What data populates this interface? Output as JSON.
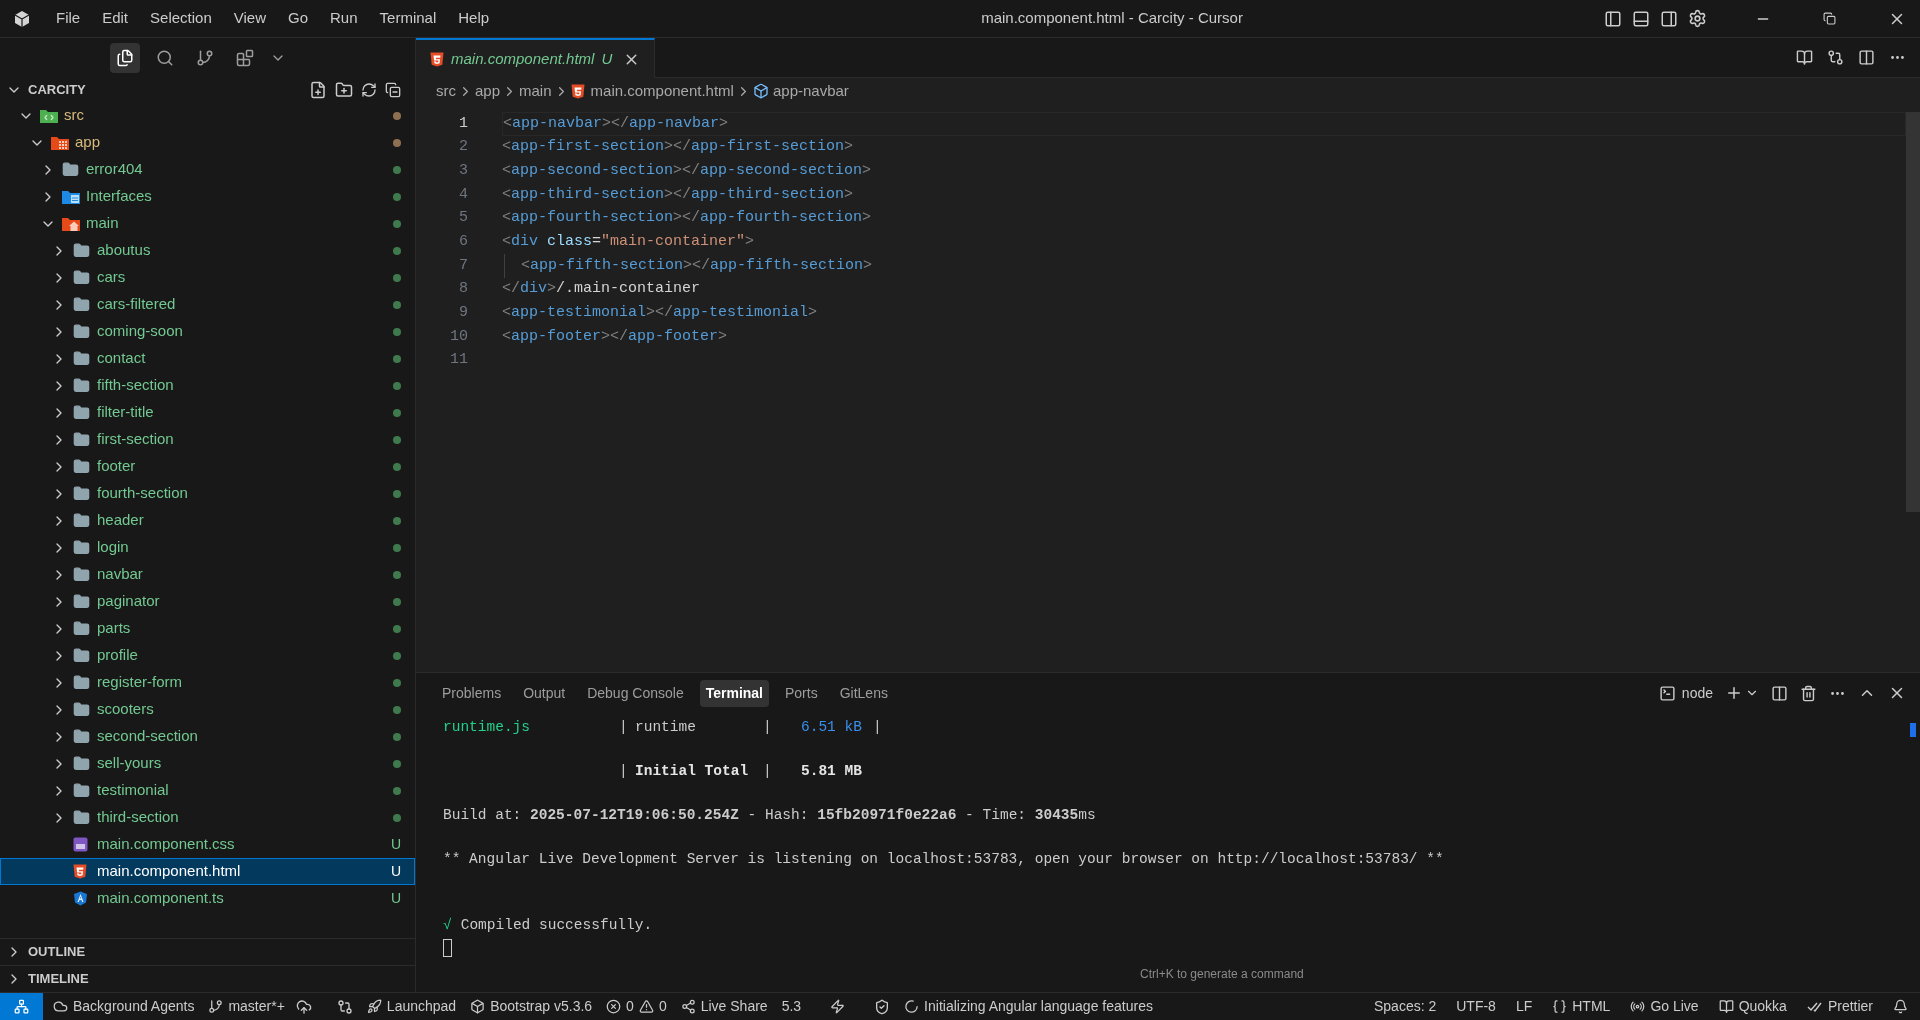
{
  "title_bar": {
    "menu": [
      "File",
      "Edit",
      "Selection",
      "View",
      "Go",
      "Run",
      "Terminal",
      "Help"
    ],
    "title": "main.component.html - Carcity - Cursor"
  },
  "activity": [
    {
      "selected": true
    },
    {
      "selected": false
    },
    {
      "selected": false
    },
    {
      "selected": false
    }
  ],
  "explorer": {
    "title": "CARCITY",
    "tree": [
      {
        "name": "src",
        "kind": "source",
        "modified": true,
        "expanded": true,
        "selected": false,
        "children": [
          {
            "name": "app",
            "kind": "app",
            "modified": true,
            "expanded": true,
            "selected": false,
            "children": [
              {
                "name": "error404",
                "kind": "folder",
                "modified": false,
                "expanded": false,
                "selected": false
              },
              {
                "name": "Interfaces",
                "kind": "interfaces",
                "modified": false,
                "expanded": false,
                "selected": false
              },
              {
                "name": "main",
                "kind": "home",
                "modified": false,
                "expanded": true,
                "selected": false,
                "children": [
                  {
                    "name": "aboutus",
                    "kind": "folder",
                    "modified": false,
                    "expanded": false,
                    "selected": false
                  },
                  {
                    "name": "cars",
                    "kind": "folder",
                    "modified": false,
                    "expanded": false,
                    "selected": false
                  },
                  {
                    "name": "cars-filtered",
                    "kind": "folder",
                    "modified": false,
                    "expanded": false,
                    "selected": false
                  },
                  {
                    "name": "coming-soon",
                    "kind": "folder",
                    "modified": false,
                    "expanded": false,
                    "selected": false
                  },
                  {
                    "name": "contact",
                    "kind": "folder",
                    "modified": false,
                    "expanded": false,
                    "selected": false
                  },
                  {
                    "name": "fifth-section",
                    "kind": "folder",
                    "modified": false,
                    "expanded": false,
                    "selected": false
                  },
                  {
                    "name": "filter-title",
                    "kind": "folder",
                    "modified": false,
                    "expanded": false,
                    "selected": false
                  },
                  {
                    "name": "first-section",
                    "kind": "folder",
                    "modified": false,
                    "expanded": false,
                    "selected": false
                  },
                  {
                    "name": "footer",
                    "kind": "folder",
                    "modified": false,
                    "expanded": false,
                    "selected": false
                  },
                  {
                    "name": "fourth-section",
                    "kind": "folder",
                    "modified": false,
                    "expanded": false,
                    "selected": false
                  },
                  {
                    "name": "header",
                    "kind": "folder",
                    "modified": false,
                    "expanded": false,
                    "selected": false
                  },
                  {
                    "name": "login",
                    "kind": "folder",
                    "modified": false,
                    "expanded": false,
                    "selected": false
                  },
                  {
                    "name": "navbar",
                    "kind": "folder",
                    "modified": false,
                    "expanded": false,
                    "selected": false
                  },
                  {
                    "name": "paginator",
                    "kind": "folder",
                    "modified": false,
                    "expanded": false,
                    "selected": false
                  },
                  {
                    "name": "parts",
                    "kind": "folder",
                    "modified": false,
                    "expanded": false,
                    "selected": false
                  },
                  {
                    "name": "profile",
                    "kind": "folder",
                    "modified": false,
                    "expanded": false,
                    "selected": false
                  },
                  {
                    "name": "register-form",
                    "kind": "folder",
                    "modified": false,
                    "expanded": false,
                    "selected": false
                  },
                  {
                    "name": "scooters",
                    "kind": "folder",
                    "modified": false,
                    "expanded": false,
                    "selected": false
                  },
                  {
                    "name": "second-section",
                    "kind": "folder",
                    "modified": false,
                    "expanded": false,
                    "selected": false
                  },
                  {
                    "name": "sell-yours",
                    "kind": "folder",
                    "modified": false,
                    "expanded": false,
                    "selected": false
                  },
                  {
                    "name": "testimonial",
                    "kind": "folder",
                    "modified": false,
                    "expanded": false,
                    "selected": false
                  },
                  {
                    "name": "third-section",
                    "kind": "folder",
                    "modified": false,
                    "expanded": false,
                    "selected": false
                  },
                  {
                    "name": "main.component.css",
                    "kind": "stylesheet",
                    "modified": false,
                    "badge": "U",
                    "selected": false
                  },
                  {
                    "name": "main.component.html",
                    "kind": "html",
                    "modified": false,
                    "badge": "U",
                    "selected": true
                  },
                  {
                    "name": "main.component.ts",
                    "kind": "angular",
                    "modified": false,
                    "badge": "U",
                    "selected": false
                  }
                ]
              }
            ]
          }
        ]
      }
    ]
  },
  "sections": [
    {
      "label": "OUTLINE",
      "expanded": false
    },
    {
      "label": "TIMELINE",
      "expanded": false
    }
  ],
  "editor": {
    "tabs": [
      {
        "label": "main.component.html",
        "status": "U",
        "selected": true
      }
    ],
    "breadcrumbs": [
      "src",
      "app",
      "main",
      "main.component.html",
      "app-navbar"
    ],
    "lines": [
      {
        "number": "1",
        "current": true,
        "tokens": [
          {
            "text": "<",
            "kind": "punct"
          },
          {
            "text": "app-navbar",
            "kind": "tag"
          },
          {
            "text": "></",
            "kind": "punct"
          },
          {
            "text": "app-navbar",
            "kind": "tag"
          },
          {
            "text": ">",
            "kind": "punct"
          }
        ]
      },
      {
        "number": "2",
        "current": false,
        "tokens": [
          {
            "text": "<",
            "kind": "punct"
          },
          {
            "text": "app-first-section",
            "kind": "tag"
          },
          {
            "text": "></",
            "kind": "punct"
          },
          {
            "text": "app-first-section",
            "kind": "tag"
          },
          {
            "text": ">",
            "kind": "punct"
          }
        ]
      },
      {
        "number": "3",
        "current": false,
        "tokens": [
          {
            "text": "<",
            "kind": "punct"
          },
          {
            "text": "app-second-section",
            "kind": "tag"
          },
          {
            "text": "></",
            "kind": "punct"
          },
          {
            "text": "app-second-section",
            "kind": "tag"
          },
          {
            "text": ">",
            "kind": "punct"
          }
        ]
      },
      {
        "number": "4",
        "current": false,
        "tokens": [
          {
            "text": "<",
            "kind": "punct"
          },
          {
            "text": "app-third-section",
            "kind": "tag"
          },
          {
            "text": "></",
            "kind": "punct"
          },
          {
            "text": "app-third-section",
            "kind": "tag"
          },
          {
            "text": ">",
            "kind": "punct"
          }
        ]
      },
      {
        "number": "5",
        "current": false,
        "tokens": [
          {
            "text": "<",
            "kind": "punct"
          },
          {
            "text": "app-fourth-section",
            "kind": "tag"
          },
          {
            "text": "></",
            "kind": "punct"
          },
          {
            "text": "app-fourth-section",
            "kind": "tag"
          },
          {
            "text": ">",
            "kind": "punct"
          }
        ]
      },
      {
        "number": "6",
        "current": false,
        "tokens": [
          {
            "text": "<",
            "kind": "punct"
          },
          {
            "text": "div",
            "kind": "tag"
          },
          {
            "text": " class",
            "kind": "attr"
          },
          {
            "text": "=",
            "kind": "plain"
          },
          {
            "text": "\"main-container\"",
            "kind": "string"
          },
          {
            "text": ">",
            "kind": "punct"
          }
        ]
      },
      {
        "number": "7",
        "current": false,
        "indent": true,
        "tokens": [
          {
            "text": "<",
            "kind": "punct"
          },
          {
            "text": "app-fifth-section",
            "kind": "tag"
          },
          {
            "text": "></",
            "kind": "punct"
          },
          {
            "text": "app-fifth-section",
            "kind": "tag"
          },
          {
            "text": ">",
            "kind": "punct"
          }
        ]
      },
      {
        "number": "8",
        "current": false,
        "tokens": [
          {
            "text": "</",
            "kind": "punct"
          },
          {
            "text": "div",
            "kind": "tag"
          },
          {
            "text": ">",
            "kind": "punct"
          },
          {
            "text": "/.main-container",
            "kind": "plain"
          }
        ]
      },
      {
        "number": "9",
        "current": false,
        "tokens": [
          {
            "text": "<",
            "kind": "punct"
          },
          {
            "text": "app-testimonial",
            "kind": "tag"
          },
          {
            "text": "></",
            "kind": "punct"
          },
          {
            "text": "app-testimonial",
            "kind": "tag"
          },
          {
            "text": ">",
            "kind": "punct"
          }
        ]
      },
      {
        "number": "10",
        "current": false,
        "tokens": [
          {
            "text": "<",
            "kind": "punct"
          },
          {
            "text": "app-footer",
            "kind": "tag"
          },
          {
            "text": "></",
            "kind": "punct"
          },
          {
            "text": "app-footer",
            "kind": "tag"
          },
          {
            "text": ">",
            "kind": "punct"
          }
        ]
      },
      {
        "number": "11",
        "current": false
      }
    ]
  },
  "panel": {
    "tabs": [
      {
        "label": "Problems",
        "selected": false
      },
      {
        "label": "Output",
        "selected": false
      },
      {
        "label": "Debug Console",
        "selected": false
      },
      {
        "label": "Terminal",
        "selected": true
      },
      {
        "label": "Ports",
        "selected": false
      },
      {
        "label": "GitLens",
        "selected": false
      }
    ],
    "terminal_name": "node",
    "lines": [
      {
        "kind": "cells",
        "cells": [
          {
            "text": "runtime.js",
            "kind": "file"
          },
          {
            "text": "|",
            "kind": "sep"
          },
          {
            "text": "runtime",
            "kind": "plain"
          },
          {
            "text": "|",
            "kind": "sep"
          },
          {
            "text": "6.51 kB",
            "kind": "size"
          },
          {
            "text": "|",
            "kind": "sep"
          }
        ]
      },
      {
        "kind": "blank"
      },
      {
        "kind": "cells",
        "cells": [
          {
            "kind": "gap"
          },
          {
            "text": "|",
            "kind": "sep"
          },
          {
            "text": "Initial Total",
            "kind": "bold"
          },
          {
            "text": "|",
            "kind": "sep"
          },
          {
            "text": "5.81 MB",
            "kind": "bold"
          }
        ]
      },
      {
        "kind": "blank"
      },
      {
        "kind": "rich",
        "text": "Build at: **2025-07-12T19:06:50.254Z** - Hash: **15fb20971f0e22a6** - Time: **30435**ms"
      },
      {
        "kind": "blank"
      },
      {
        "kind": "plain",
        "text": "** Angular Live Development Server is listening on localhost:53783, open your browser on http://localhost:53783/ **"
      },
      {
        "kind": "blank"
      },
      {
        "kind": "blank"
      },
      {
        "kind": "success",
        "mark": "√",
        "text": "Compiled successfully."
      },
      {
        "kind": "cursor"
      }
    ],
    "hint": "Ctrl+K to generate a command"
  },
  "status_bar": {
    "left": [
      {
        "kind": "text",
        "text": "Background Agents"
      },
      {
        "kind": "text",
        "text": "master*+"
      },
      {
        "kind": "text",
        "text": "Launchpad"
      },
      {
        "kind": "text",
        "text": "Bootstrap v5.3.6"
      },
      {
        "kind": "problems",
        "errors": "0",
        "warnings": "0"
      },
      {
        "kind": "text",
        "text": "Live Share"
      },
      {
        "kind": "text",
        "text": "5.3"
      },
      {
        "kind": "text",
        "text": "Initializing Angular language features"
      }
    ],
    "right": [
      "Spaces: 2",
      "UTF-8",
      "LF",
      "HTML",
      "Go Live",
      "Quokka",
      "Prettier"
    ]
  }
}
